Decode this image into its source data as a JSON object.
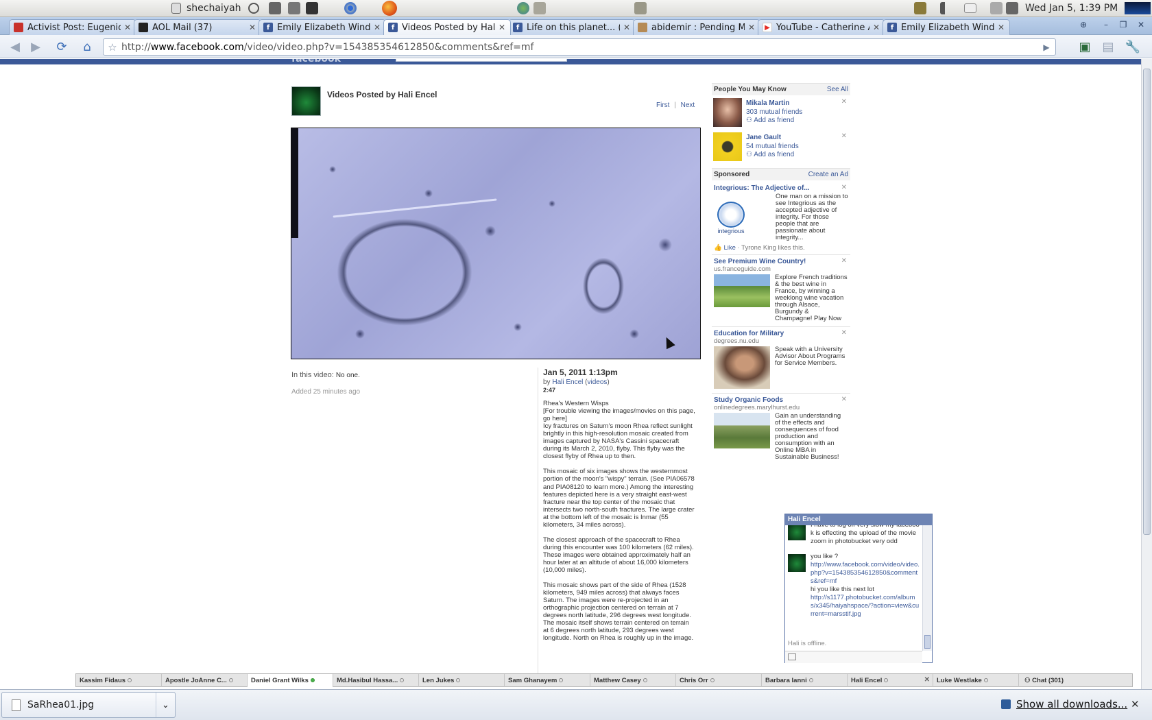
{
  "system_panel": {
    "user": "shechaiyah",
    "clock": "Wed Jan  5,  1:39 PM"
  },
  "tabs": [
    {
      "label": "Activist Post: Eugenic...",
      "favicon": "red"
    },
    {
      "label": "AOL Mail (37)",
      "favicon": "aol"
    },
    {
      "label": "Emily Elizabeth Wind...",
      "favicon": "fb"
    },
    {
      "label": "Videos Posted by Hali...",
      "favicon": "fb",
      "active": true
    },
    {
      "label": "Life on this planet... (...",
      "favicon": "fb"
    },
    {
      "label": "abidemir : Pending M...",
      "favicon": "user"
    },
    {
      "label": "YouTube - Catherine A...",
      "favicon": "yt"
    },
    {
      "label": "Emily Elizabeth Wind...",
      "favicon": "fb"
    }
  ],
  "address_bar": {
    "url_prefix": "http://",
    "url_host": "www.facebook.com",
    "url_path": "/video/video.php?v=154385354612850&comments&ref=mf"
  },
  "page": {
    "header_logo": "facebook",
    "title": "Videos Posted by Hali Encel",
    "pager_first": "First",
    "pager_sep": "|",
    "pager_next": "Next",
    "in_this_video_label": "In this video:",
    "in_this_video_value": "No one.",
    "added": "Added 25 minutes ago",
    "post_date": "Jan 5, 2011 1:13pm",
    "by_prefix": "by",
    "by_name": "Hali Encel",
    "by_videos": "videos",
    "duration": "2:47",
    "description": "Rhea's Western Wisps\n[For trouble viewing the images/movies on this page, go here]\nIcy fractures on Saturn's moon Rhea reflect sunlight brightly in this high-resolution mosaic created from images captured by NASA's Cassini spacecraft during its March 2, 2010, flyby. This flyby was the closest flyby of Rhea up to then.\n\nThis mosaic of six images shows the westernmost portion of the moon's \"wispy\" terrain. (See PIA06578 and PIA08120 to learn more.) Among the interesting features depicted here is a very straight east-west fracture near the top center of the mosaic that intersects two north-south fractures. The large crater at the bottom left of the mosaic is Inmar (55 kilometers, 34 miles across).\n\nThe closest approach of the spacecraft to Rhea during this encounter was 100 kilometers (62 miles). These images were obtained approximately half an hour later at an altitude of about 16,000 kilometers (10,000 miles).\n\nThis mosaic shows part of the side of Rhea (1528 kilometers, 949 miles across) that always faces Saturn. The images were re-projected in an orthographic projection centered on terrain at 7 degrees north latitude, 296 degrees west longitude. The mosaic itself shows terrain centered on terrain at 6 degrees north latitude, 293 degrees west longitude. North on Rhea is roughly up in the image."
  },
  "people_you_may_know": {
    "heading": "People You May Know",
    "see_all": "See All",
    "people": [
      {
        "name": "Mikala Martin",
        "mutual": "303 mutual friends",
        "action": "Add as friend"
      },
      {
        "name": "Jane Gault",
        "mutual": "54 mutual friends",
        "action": "Add as friend"
      }
    ]
  },
  "sponsored": {
    "heading": "Sponsored",
    "create_ad": "Create an Ad",
    "ads": [
      {
        "title": "Integrious: The Adjective of...",
        "domain": "",
        "body": "One man on a mission to see Integrious as the accepted adjective of integrity. For those people that are passionate about integrity...",
        "like": "Like",
        "like_note": "· Tyrone King likes this.",
        "logo_text": "integrious"
      },
      {
        "title": "See Premium Wine Country!",
        "domain": "us.franceguide.com",
        "body": "Explore French traditions & the best wine in France, by winning a weeklong wine vacation through Alsace, Burgundy & Champagne! Play Now"
      },
      {
        "title": "Education for Military",
        "domain": "degrees.nu.edu",
        "body": "Speak with a University Advisor About Programs for Service Members."
      },
      {
        "title": "Study Organic Foods",
        "domain": "onlinedegrees.marylhurst.edu",
        "body": "Gain an understanding of the effects and consequences of food production and consumption with an Online MBA in Sustainable Business!"
      }
    ]
  },
  "chat_window": {
    "name": "Hali Encel",
    "messages": [
      {
        "text": "I have to log off very slow my facebook is effecting the upload of the movie zoom in photobucket very odd"
      },
      {
        "text": "you like ?",
        "link": "http://www.facebook.com/video/video.php?v=154385354612850&comments&ref=mf",
        "text2": "hi you like this next lot",
        "link2": "http://s1177.photobucket.com/albums/x345/haiyahspace/?action=view&current=marsstif.jpg"
      }
    ],
    "status": "Hali is offline."
  },
  "chat_bar": {
    "items": [
      {
        "name": "Kassim Fidaus",
        "online": false
      },
      {
        "name": "Apostle JoAnne C...",
        "online": false
      },
      {
        "name": "Daniel Grant Wilks",
        "online": true,
        "active": true
      },
      {
        "name": "Md.Hasibul Hassa...",
        "online": false
      },
      {
        "name": "Len Jukes",
        "online": false
      },
      {
        "name": "Sam Ghanayem",
        "online": false
      },
      {
        "name": "Matthew Casey",
        "online": false
      },
      {
        "name": "Chris Orr",
        "online": false
      },
      {
        "name": "Barbara Ianni",
        "online": false
      },
      {
        "name": "Hali Encel",
        "online": false,
        "closable": true
      },
      {
        "name": "Luke Westlake",
        "online": false
      }
    ],
    "chat_label": "Chat (301)"
  },
  "download_shelf": {
    "file": "SaRhea01.jpg",
    "show_all": "Show all downloads...",
    "close": "✕"
  }
}
